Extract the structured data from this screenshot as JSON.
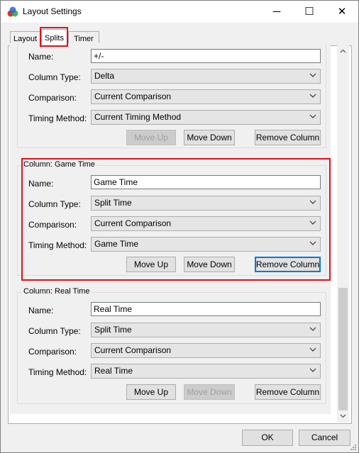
{
  "window": {
    "title": "Layout Settings",
    "minimize_glyph": "─",
    "maximize_glyph": "☐",
    "close_glyph": "✕"
  },
  "tabs": [
    {
      "label": "Layout",
      "active": false
    },
    {
      "label": "Splits",
      "active": true
    },
    {
      "label": "Timer",
      "active": false
    }
  ],
  "labels": {
    "name": "Name:",
    "column_type": "Column Type:",
    "comparison": "Comparison:",
    "timing_method": "Timing Method:"
  },
  "columns": [
    {
      "legend": "",
      "name": "+/-",
      "column_type": "Delta",
      "comparison": "Current Comparison",
      "timing_method": "Current Timing Method",
      "move_up": "Move Up",
      "move_up_enabled": false,
      "move_down": "Move Down",
      "move_down_enabled": true,
      "remove": "Remove Column"
    },
    {
      "legend": "Column: Game Time",
      "name": "Game Time",
      "column_type": "Split Time",
      "comparison": "Current Comparison",
      "timing_method": "Game Time",
      "move_up": "Move Up",
      "move_up_enabled": true,
      "move_down": "Move Down",
      "move_down_enabled": true,
      "remove": "Remove Column"
    },
    {
      "legend": "Column: Real Time",
      "name": "Real Time",
      "column_type": "Split Time",
      "comparison": "Current Comparison",
      "timing_method": "Real Time",
      "move_up": "Move Up",
      "move_up_enabled": true,
      "move_down": "Move Down",
      "move_down_enabled": false,
      "remove": "Remove Column"
    }
  ],
  "footer": {
    "ok": "OK",
    "cancel": "Cancel"
  },
  "colors": {
    "highlight": "#e0101a",
    "focus": "#0078d7"
  }
}
